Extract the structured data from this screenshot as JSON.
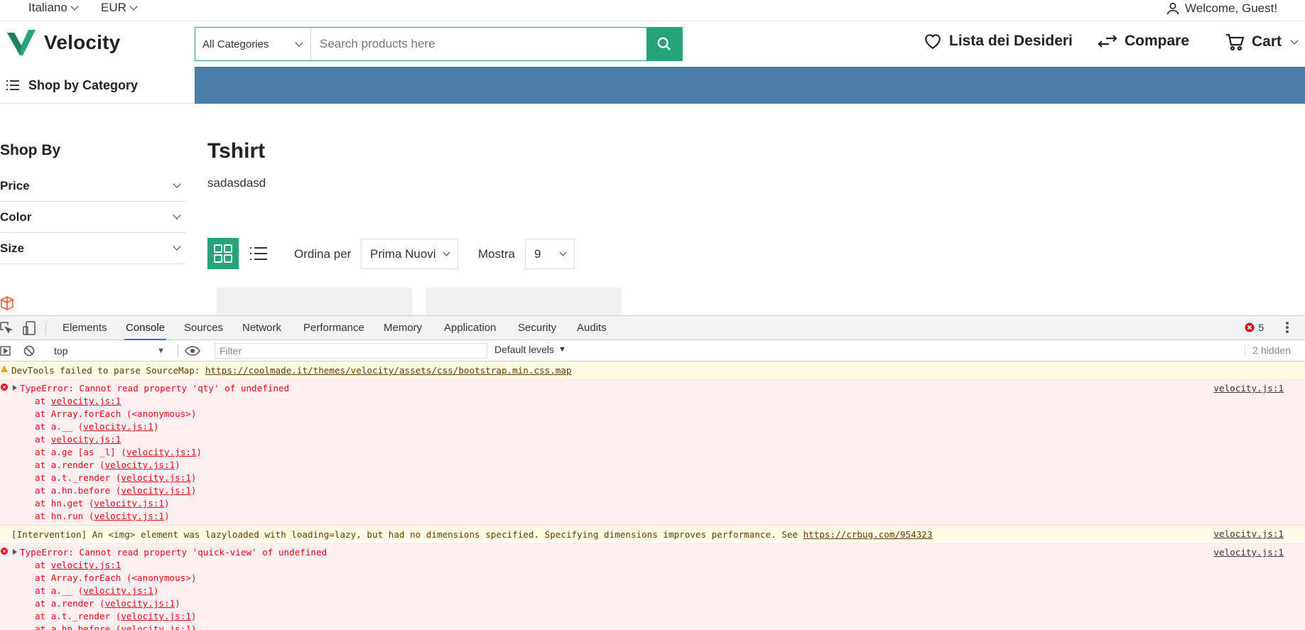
{
  "topbar": {
    "language": "Italiano",
    "currency": "EUR",
    "welcome": "Welcome, Guest!"
  },
  "header": {
    "logo_text": "Velocity",
    "search": {
      "category": "All Categories",
      "placeholder": "Search products here"
    },
    "wishlist": "Lista dei Desideri",
    "compare": "Compare",
    "cart": "Cart"
  },
  "nav": {
    "shop_by_category": "Shop by Category"
  },
  "sidebar": {
    "heading": "Shop By",
    "filters": [
      "Price",
      "Color",
      "Size"
    ]
  },
  "main": {
    "title": "Tshirt",
    "description": "sadasdasd",
    "sort_label": "Ordina per",
    "sort_value": "Prima Nuovi",
    "show_label": "Mostra",
    "show_value": "9"
  },
  "devtools": {
    "tabs": [
      "Elements",
      "Console",
      "Sources",
      "Network",
      "Performance",
      "Memory",
      "Application",
      "Security",
      "Audits"
    ],
    "active_tab": "Console",
    "error_count": "5",
    "context": "top",
    "filter_placeholder": "Filter",
    "levels": "Default levels",
    "hidden": "2 hidden",
    "messages": {
      "sourcemap_prefix": "DevTools failed to parse SourceMap: ",
      "sourcemap_url": "https://coolmade.it/themes/velocity/assets/css/bootstrap.min.css.map",
      "err1_text": "TypeError: Cannot read property 'qty' of undefined",
      "err1_src": "velocity.js:1",
      "intervention_text": "[Intervention] An <img> element was lazyloaded with loading=lazy, but had no dimensions specified. Specifying dimensions improves performance. See ",
      "intervention_url": "https://crbug.com/954323",
      "intervention_src": "velocity.js:1",
      "err2_text": "TypeError: Cannot read property 'quick-view' of undefined",
      "err2_src": "velocity.js:1"
    }
  },
  "colors": {
    "accent": "#26a37a",
    "nav_band": "#4a7ea8",
    "error_text": "#e5001f",
    "error_bg": "#fef0f0",
    "warn_bg": "#fffbe5"
  }
}
